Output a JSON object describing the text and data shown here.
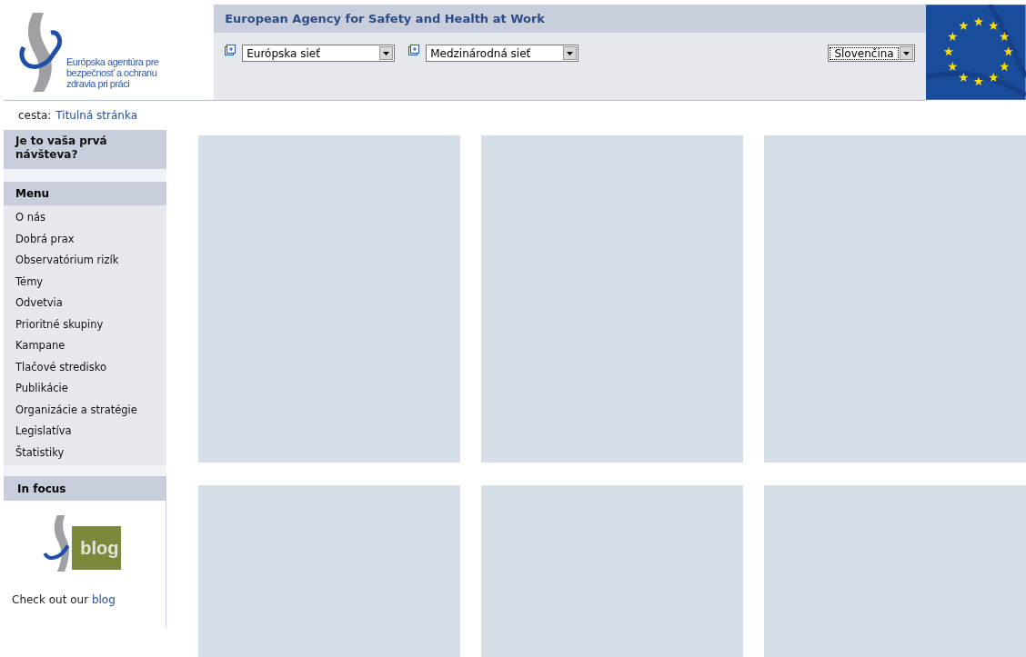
{
  "logo": {
    "lines": [
      "Európska agentúra pre",
      "bezpečnosť a ochranu",
      "zdravia pri práci"
    ]
  },
  "header": {
    "title": "European Agency for Safety and Health at Work",
    "dropdowns": [
      {
        "value": "Európska sieť"
      },
      {
        "value": "Medzinárodná sieť"
      }
    ],
    "language": {
      "value": "Slovenčina"
    }
  },
  "breadcrumb": {
    "label": "cesta:",
    "link": "Titulná stránka"
  },
  "sidebar": {
    "first_visit": "Je to vaša prvá návšteva?",
    "menu": {
      "title": "Menu",
      "items": [
        "O nás",
        "Dobrá prax",
        "Observatórium rizík",
        "Témy",
        "Odvetvia",
        "Prioritné skupiny",
        "Kampane",
        "Tlačové stredisko",
        "Publikácie",
        "Organizácie a stratégie",
        "Legislatíva",
        "Štatistiky"
      ]
    },
    "in_focus": {
      "title": "In focus",
      "logo_text": "blog",
      "text": "Check out our",
      "link": "blog"
    }
  },
  "panels": [
    {
      "kind": "empty"
    },
    {
      "kind": "empty"
    },
    {
      "kind": "empty"
    },
    {
      "kind": "empty"
    },
    {
      "kind": "empty"
    },
    {
      "kind": "empty"
    }
  ]
}
